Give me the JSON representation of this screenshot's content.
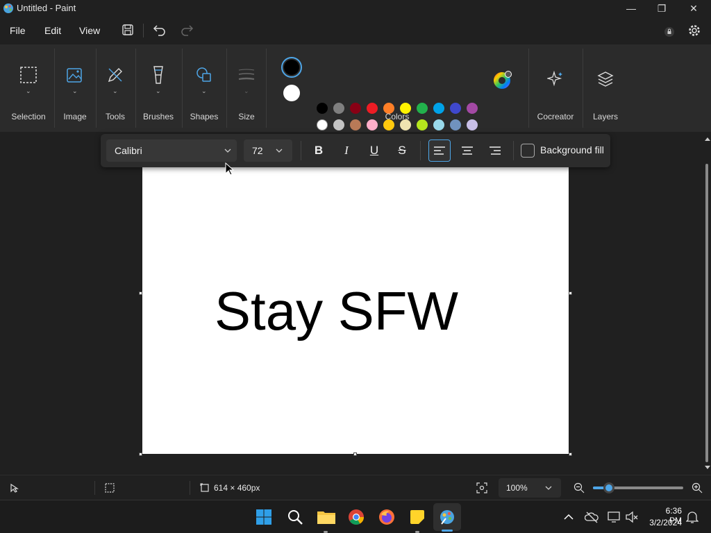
{
  "window": {
    "title": "Untitled - Paint",
    "minimize": "—",
    "restore": "❐",
    "close": "✕"
  },
  "menu": {
    "file": "File",
    "edit": "Edit",
    "view": "View"
  },
  "ribbon": {
    "selection": "Selection",
    "image": "Image",
    "tools": "Tools",
    "brushes": "Brushes",
    "shapes": "Shapes",
    "size": "Size",
    "colors": "Colors",
    "cocreator": "Cocreator",
    "layers": "Layers",
    "primary_color": "#000000",
    "secondary_color": "#ffffff",
    "palette_row1": [
      "#000000",
      "#7f7f7f",
      "#880015",
      "#ed1c24",
      "#ff7f27",
      "#fff200",
      "#22b14c",
      "#00a2e8",
      "#3f48cc",
      "#a349a4"
    ],
    "palette_row2": [
      "#ffffff",
      "#c3c3c3",
      "#b97a57",
      "#ffaec9",
      "#ffc90e",
      "#efe4b0",
      "#b5e61d",
      "#99d9ea",
      "#7092be",
      "#c8bfe7"
    ]
  },
  "text_toolbar": {
    "font": "Calibri",
    "size": "72",
    "bold": "B",
    "italic": "I",
    "underline": "U",
    "strike": "S",
    "background_fill": "Background fill"
  },
  "canvas": {
    "text": "Stay SFW"
  },
  "status": {
    "dimensions": "614 × 460px",
    "zoom": "100%",
    "zoom_slider_level": 0.18
  },
  "taskbar": {
    "time": "6:36 PM",
    "date": "3/2/2024"
  }
}
